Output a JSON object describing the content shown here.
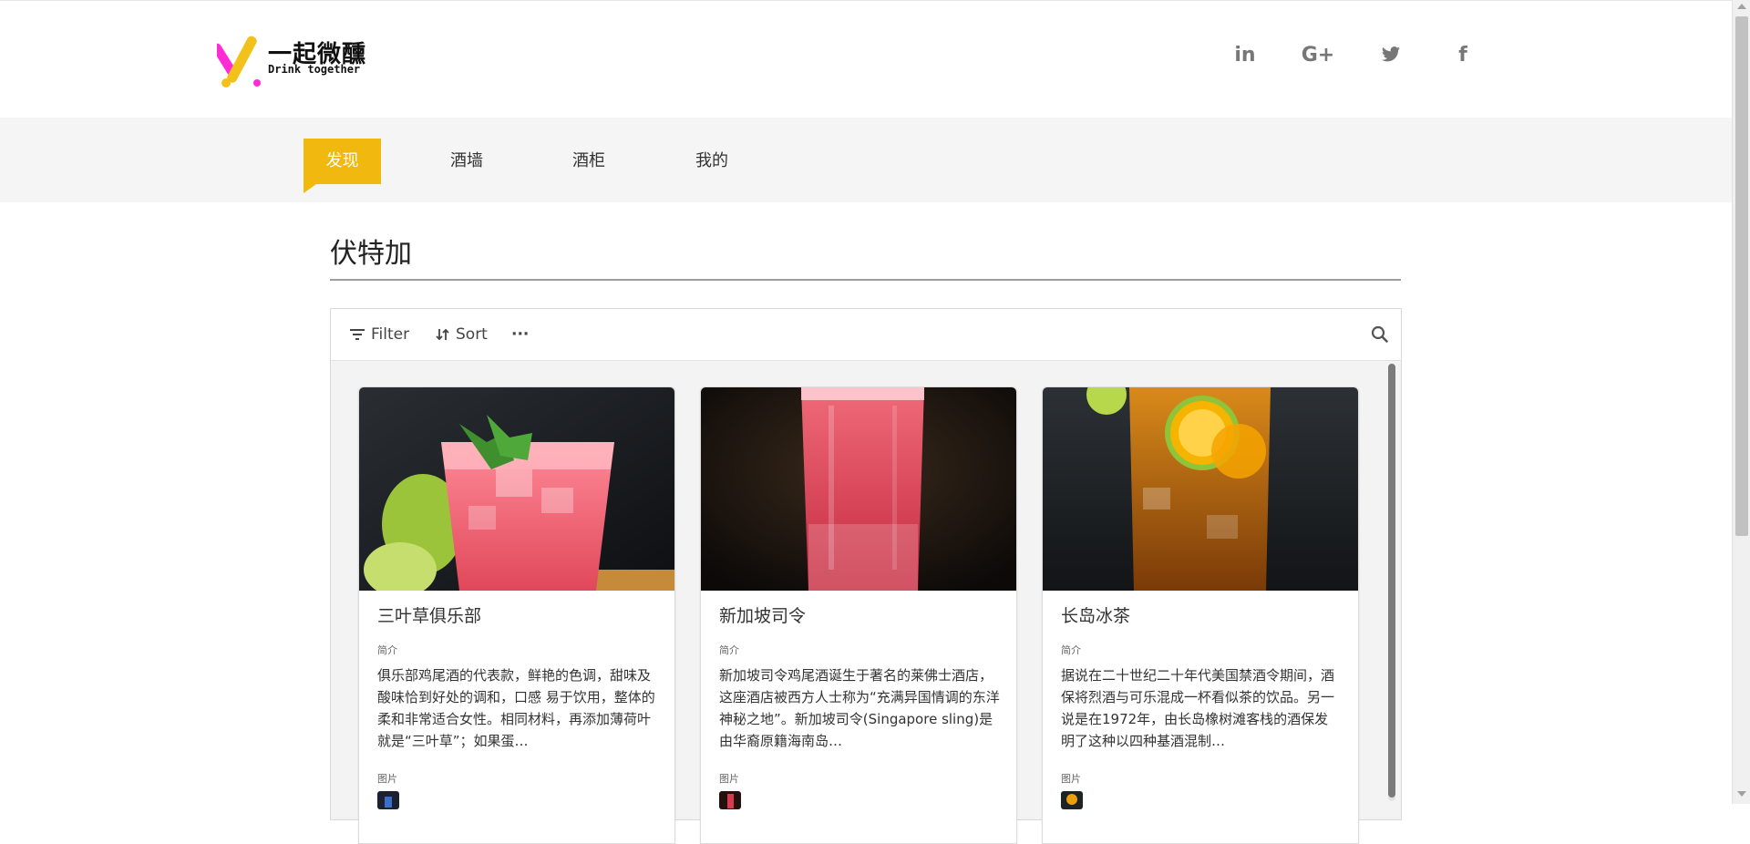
{
  "brand": {
    "name_cn": "一起微醺",
    "tagline": "Drink together",
    "accent": "#f1b80f"
  },
  "social": [
    {
      "label": "in",
      "icon": "linkedin-icon"
    },
    {
      "label": "G+",
      "icon": "google-plus-icon"
    },
    {
      "label": "",
      "icon": "twitter-icon"
    },
    {
      "label": "f",
      "icon": "facebook-icon"
    }
  ],
  "nav": [
    {
      "label": "发现",
      "active": true
    },
    {
      "label": "酒墙",
      "active": false
    },
    {
      "label": "酒柜",
      "active": false
    },
    {
      "label": "我的",
      "active": false
    }
  ],
  "section": {
    "title": "伏特加"
  },
  "toolbar": {
    "filter_label": "Filter",
    "sort_label": "Sort",
    "more_label": "···"
  },
  "cards": [
    {
      "title": "三叶草俱乐部",
      "intro_label": "简介",
      "description": "俱乐部鸡尾酒的代表款，鲜艳的色调，甜味及酸味恰到好处的调和，口感 易于饮用，整体的柔和非常适合女性。相同材料，再添加薄荷叶就是“三叶草”；如果蛋…",
      "image_label": "图片",
      "image_icon": "red-cocktail-photo"
    },
    {
      "title": "新加坡司令",
      "intro_label": "简介",
      "description": " 新加坡司令鸡尾酒诞生于著名的莱佛士酒店，这座酒店被西方人士称为“充满异国情调的东洋神秘之地”。新加坡司令(Singapore sling)是由华裔原籍海南岛…",
      "image_label": "图片",
      "image_icon": "pink-highball-photo"
    },
    {
      "title": "长岛冰茶",
      "intro_label": "简介",
      "description": "据说在二十世纪二十年代美国禁酒令期间，酒保将烈酒与可乐混成一杯看似茶的饮品。另一说是在1972年，由长岛橡树滩客栈的酒保发明了这种以四种基酒混制…",
      "image_label": "图片",
      "image_icon": "iced-tea-photo"
    }
  ]
}
